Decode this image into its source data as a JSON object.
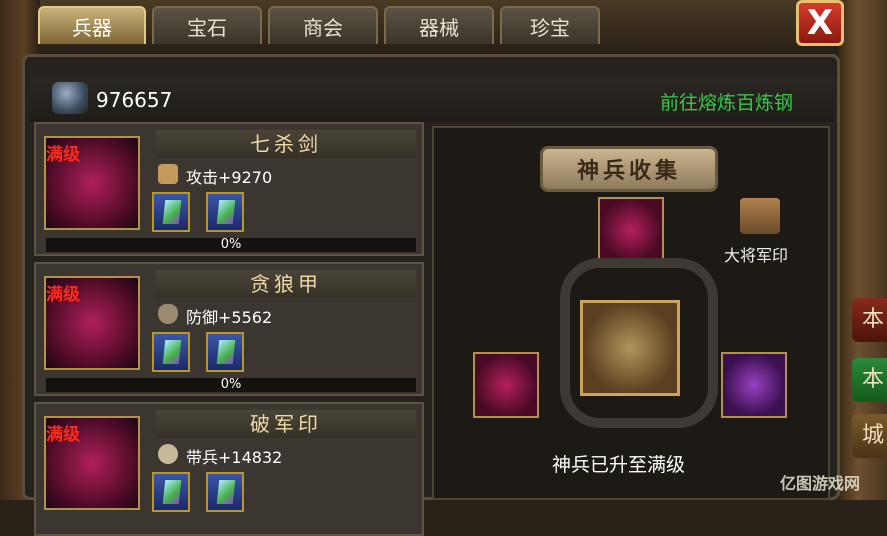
{
  "tabs": [
    {
      "label": "兵器",
      "active": true
    },
    {
      "label": "宝石",
      "active": false
    },
    {
      "label": "商会",
      "active": false
    },
    {
      "label": "器械",
      "active": false
    },
    {
      "label": "珍宝",
      "active": false
    }
  ],
  "close_label": "X",
  "resource": {
    "value": "976657",
    "icon": "steel-ore-icon"
  },
  "goto_link": "前往熔炼百炼钢",
  "items": [
    {
      "level": "满级",
      "name": "七杀剑",
      "stat": "攻击+9270",
      "stat_icon": "sword-icon",
      "progress_label": "0%"
    },
    {
      "level": "满级",
      "name": "贪狼甲",
      "stat": "防御+5562",
      "stat_icon": "shield-icon",
      "progress_label": "0%"
    },
    {
      "level": "满级",
      "name": "破军印",
      "stat": "带兵+14832",
      "stat_icon": "soldier-icon",
      "progress_label": ""
    }
  ],
  "collection": {
    "title": "神兵收集",
    "side_item_label": "大将军印",
    "status": "神兵已升至满级"
  },
  "side_buttons": [
    "本",
    "本",
    "城"
  ],
  "watermark": "亿图游戏网"
}
